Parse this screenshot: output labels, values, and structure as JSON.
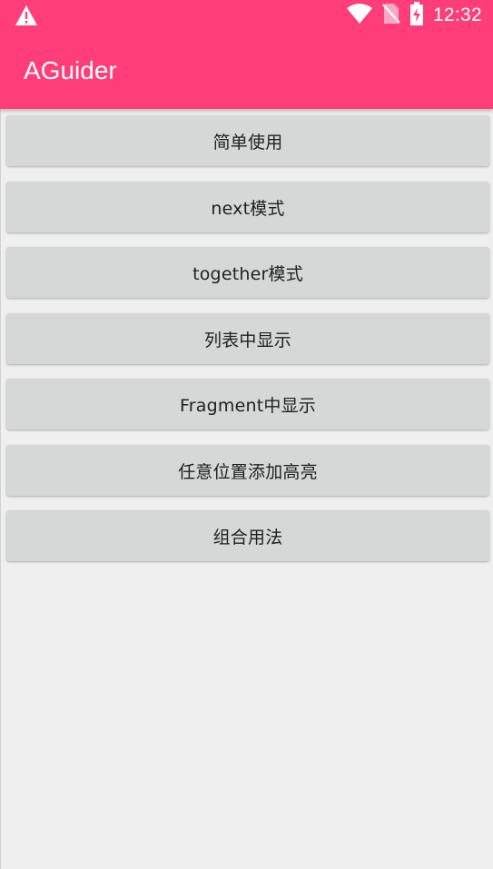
{
  "status_bar": {
    "time": "12:32",
    "icons": [
      "warning-icon",
      "wifi-icon",
      "no-sim-icon",
      "battery-charging-icon"
    ]
  },
  "toolbar": {
    "title": "AGuider"
  },
  "buttons": [
    {
      "label": "简单使用"
    },
    {
      "label": "next模式"
    },
    {
      "label": "together模式"
    },
    {
      "label": "列表中显示"
    },
    {
      "label": "Fragment中显示"
    },
    {
      "label": "任意位置添加高亮"
    },
    {
      "label": "组合用法"
    }
  ],
  "colors": {
    "primary": "#ff3d79",
    "background": "#efefef",
    "button": "#d6d7d7"
  }
}
